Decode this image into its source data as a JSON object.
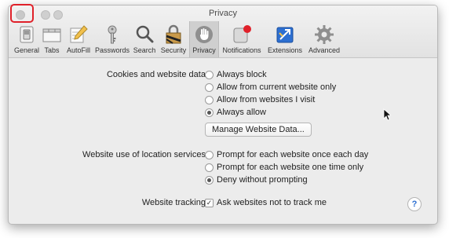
{
  "window": {
    "title": "Privacy"
  },
  "toolbar": {
    "items": [
      {
        "label": "General",
        "icon": "general-switch-icon"
      },
      {
        "label": "Tabs",
        "icon": "tabs-icon"
      },
      {
        "label": "AutoFill",
        "icon": "autofill-pencil-icon"
      },
      {
        "label": "Passwords",
        "icon": "key-icon"
      },
      {
        "label": "Search",
        "icon": "magnifier-icon"
      },
      {
        "label": "Security",
        "icon": "lock-icon"
      },
      {
        "label": "Privacy",
        "icon": "hand-icon",
        "active": true
      },
      {
        "label": "Notifications",
        "icon": "notification-badge-icon"
      },
      {
        "label": "Extensions",
        "icon": "puzzle-icon"
      },
      {
        "label": "Advanced",
        "icon": "gear-icon"
      }
    ]
  },
  "cookies": {
    "label": "Cookies and website data:",
    "options": [
      {
        "label": "Always block",
        "selected": false
      },
      {
        "label": "Allow from current website only",
        "selected": false
      },
      {
        "label": "Allow from websites I visit",
        "selected": false
      },
      {
        "label": "Always allow",
        "selected": true
      }
    ],
    "manage_button": "Manage Website Data..."
  },
  "location": {
    "label": "Website use of location services:",
    "options": [
      {
        "label": "Prompt for each website once each day",
        "selected": false
      },
      {
        "label": "Prompt for each website one time only",
        "selected": false
      },
      {
        "label": "Deny without prompting",
        "selected": true
      }
    ]
  },
  "tracking": {
    "label": "Website tracking:",
    "checkbox_label": "Ask websites not to track me",
    "checked": true
  },
  "help": {
    "symbol": "?"
  },
  "colors": {
    "highlight_ring": "#e0212a",
    "notification_dot": "#e0212a",
    "extensions_blue": "#2d6fd1"
  }
}
